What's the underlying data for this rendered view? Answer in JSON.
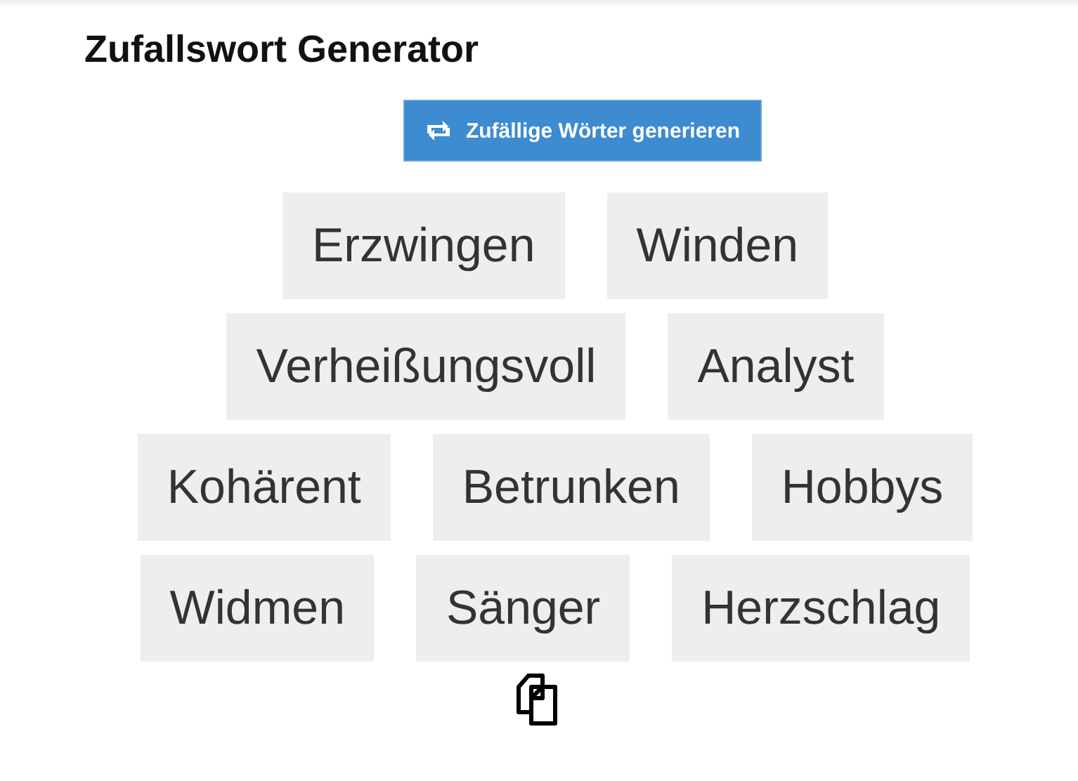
{
  "title": "Zufallswort Generator",
  "generate_button": {
    "label": "Zufällige Wörter generieren"
  },
  "words": [
    "Erzwingen",
    "Winden",
    "Verheißungsvoll",
    "Analyst",
    "Kohärent",
    "Betrunken",
    "Hobbys",
    "Widmen",
    "Sänger",
    "Herzschlag"
  ]
}
